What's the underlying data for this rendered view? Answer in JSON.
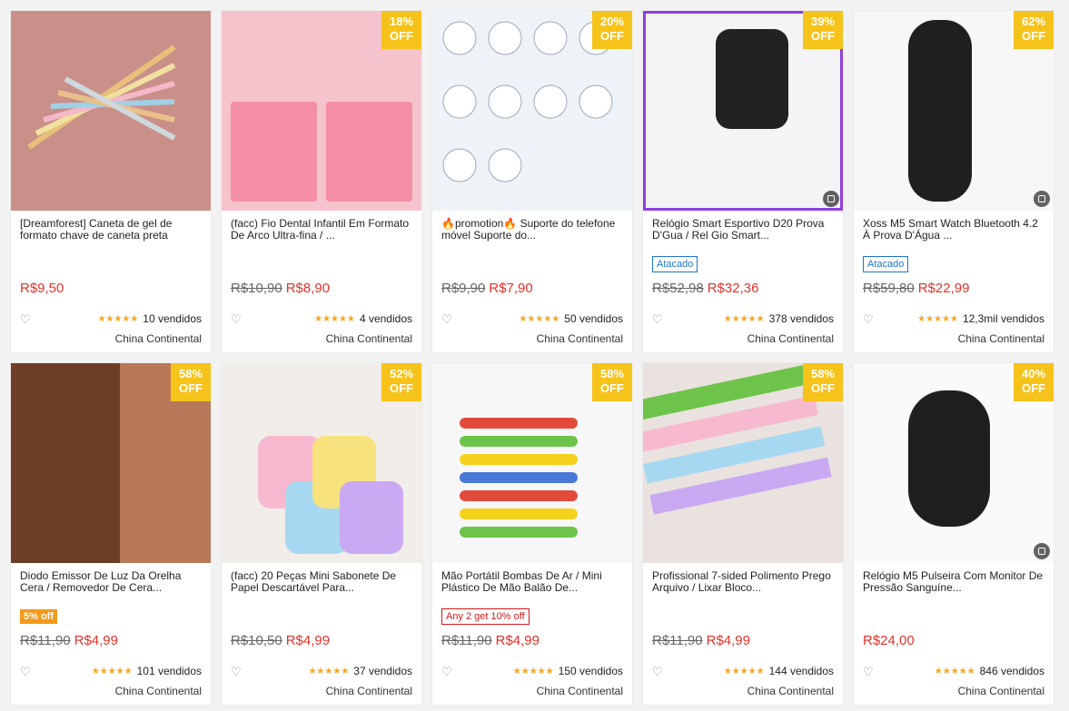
{
  "products": [
    {
      "title": "[Dreamforest] Caneta de gel de formato chave de caneta preta",
      "discount": "",
      "old_price": "",
      "price": "R$9,50",
      "tag": "",
      "tag_type": "",
      "sold": "10 vendidos",
      "origin": "China Continental",
      "bg": "#c9908a",
      "video": false
    },
    {
      "title": "(facc) Fio Dental Infantil Em Formato De Arco Ultra-fina / ...",
      "discount": "18%",
      "old_price": "R$10,90",
      "price": "R$8,90",
      "tag": "",
      "tag_type": "",
      "sold": "4 vendidos",
      "origin": "China Continental",
      "bg": "#f5c3cc",
      "video": false
    },
    {
      "title": "🔥promotion🔥 Suporte do telefone móvel Suporte do...",
      "discount": "20%",
      "old_price": "R$9,90",
      "price": "R$7,90",
      "tag": "",
      "tag_type": "",
      "sold": "50 vendidos",
      "origin": "China Continental",
      "bg": "#eef3f8",
      "video": false
    },
    {
      "title": "Relógio Smart Esportivo D20 Prova D'Gua / Rel Gio Smart...",
      "discount": "39%",
      "old_price": "R$52,98",
      "price": "R$32,36",
      "tag": "Atacado",
      "tag_type": "atacado",
      "sold": "378 vendidos",
      "origin": "China Continental",
      "bg": "#f4f4f6",
      "video": true
    },
    {
      "title": "Xoss M5 Smart Watch Bluetooth 4.2 À Prova D'Água ...",
      "discount": "62%",
      "old_price": "R$59,80",
      "price": "R$22,99",
      "tag": "Atacado",
      "tag_type": "atacado",
      "sold": "12,3mil vendidos",
      "origin": "China Continental",
      "bg": "#f7f7f7",
      "video": true
    },
    {
      "title": "Diodo Emissor De Luz Da Orelha Cera / Removedor De Cera...",
      "discount": "58%",
      "old_price": "R$11,90",
      "price": "R$4,99",
      "tag": "5% off",
      "tag_type": "discount",
      "sold": "101 vendidos",
      "origin": "China Continental",
      "bg": "#b97857",
      "video": false
    },
    {
      "title": "(facc) 20 Peças Mini Sabonete De Papel Descartável Para...",
      "discount": "52%",
      "old_price": "R$10,50",
      "price": "R$4,99",
      "tag": "",
      "tag_type": "",
      "sold": "37 vendidos",
      "origin": "China Continental",
      "bg": "#f1ede9",
      "video": false
    },
    {
      "title": "Mão Portátil Bombas De Ar / Mini Plástico De Mão Balão De...",
      "discount": "58%",
      "old_price": "R$11,90",
      "price": "R$4,99",
      "tag": "Any 2 get 10% off",
      "tag_type": "promo",
      "sold": "150 vendidos",
      "origin": "China Continental",
      "bg": "#f7f7f7",
      "video": false
    },
    {
      "title": "Profissional 7-sided Polimento Prego Arquivo / Lixar Bloco...",
      "discount": "58%",
      "old_price": "R$11,90",
      "price": "R$4,99",
      "tag": "",
      "tag_type": "",
      "sold": "144 vendidos",
      "origin": "China Continental",
      "bg": "#e9e2df",
      "video": false
    },
    {
      "title": "Relógio M5 Pulseira Com Monitor De Pressão Sanguíne...",
      "discount": "40%",
      "old_price": "",
      "price": "R$24,00",
      "tag": "",
      "tag_type": "",
      "sold": "846 vendidos",
      "origin": "China Continental",
      "bg": "#fafafa",
      "video": true
    }
  ],
  "badge_off": "OFF",
  "stars": "★★★★★",
  "heart": "♡"
}
